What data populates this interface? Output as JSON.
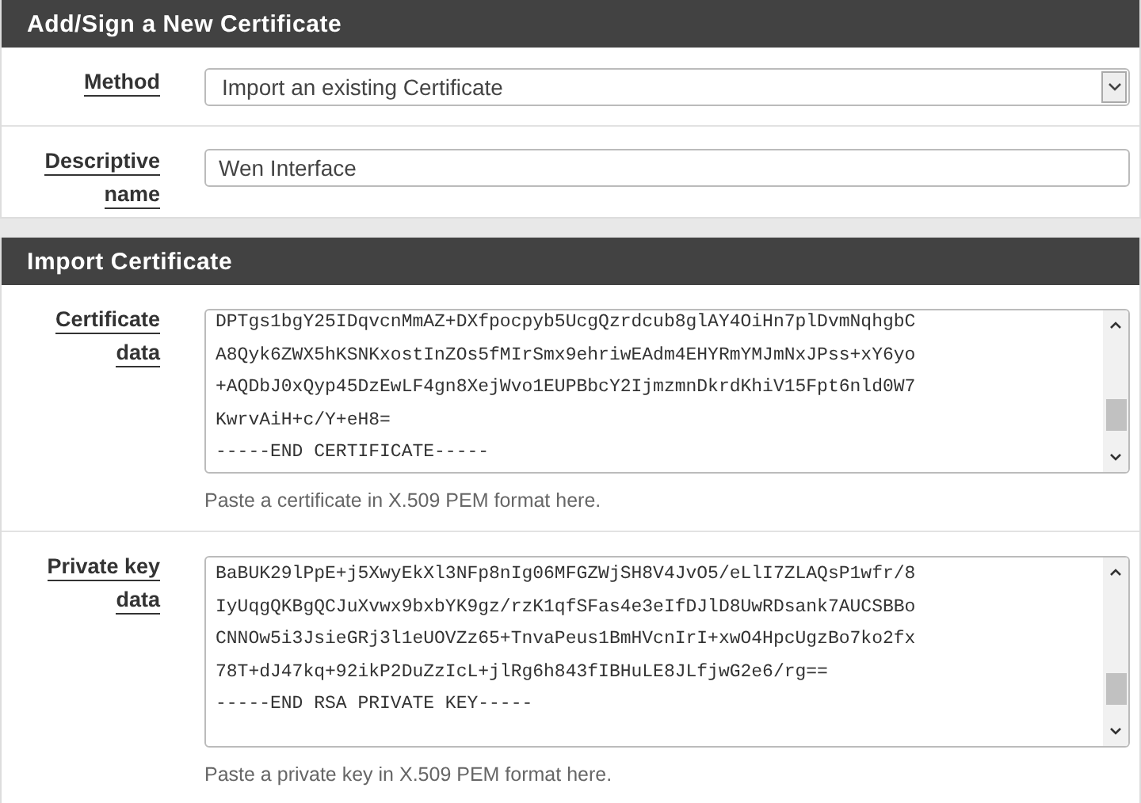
{
  "sections": [
    {
      "title": "Add/Sign a New Certificate",
      "rows": [
        {
          "kind": "select",
          "label": [
            "Method"
          ],
          "value": "Import an existing Certificate"
        },
        {
          "kind": "input",
          "label": [
            "Descriptive",
            "name"
          ],
          "value": "Wen Interface"
        }
      ]
    },
    {
      "title": "Import Certificate",
      "rows": [
        {
          "kind": "textarea",
          "label": [
            "Certificate",
            "data"
          ],
          "lines": [
            "DPTgs1bgY25IDqvcnMmAZ+DXfpocpyb5UcgQzrdcub8glAY4OiHn7plDvmNqhgbC",
            "A8Qyk6ZWX5hKSNKxostInZOs5fMIrSmx9ehriwEAdm4EHYRmYMJmNxJPss+xY6yo",
            "+AQDbJ0xQyp45DzEwLF4gn8XejWvo1EUPBbcY2IjmzmnDkrdKhiV15Fpt6nld0W7",
            "KwrvAiH+c/Y+eH8=",
            "-----END CERTIFICATE-----"
          ],
          "help": "Paste a certificate in X.509 PEM format here."
        },
        {
          "kind": "textarea",
          "label": [
            "Private key",
            "data"
          ],
          "lines": [
            "BaBUK29lPpE+j5XwyEkXl3NFp8nIg06MFGZWjSH8V4JvO5/eLlI7ZLAQsP1wfr/8",
            "IyUqgQKBgQCJuXvwx9bxbYK9gz/rzK1qfSFas4e3eIfDJlD8UwRDsank7AUCSBBo",
            "CNNOw5i3JsieGRj3l1eUOVZz65+TnvaPeus1BmHVcnIrI+xwO4HpcUgzBo7ko2fx",
            "78T+dJ47kq+92ikP2DuZzIcL+jlRg6h843fIBHuLE8JLfjwG2e6/rg==",
            "-----END RSA PRIVATE KEY-----"
          ],
          "help": "Paste a private key in X.509 PEM format here."
        }
      ]
    }
  ]
}
